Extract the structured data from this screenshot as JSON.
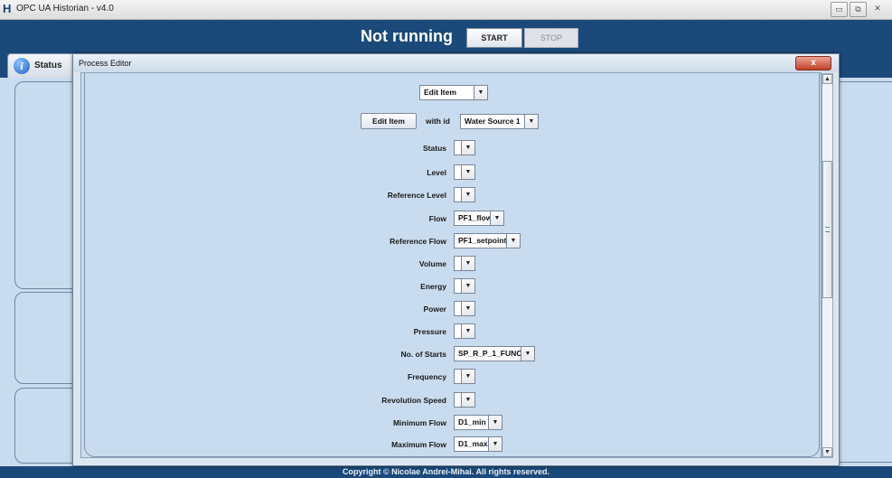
{
  "window": {
    "title": "OPC UA Historian - v4.0",
    "app_icon_glyph": "H",
    "controls": [
      "▭",
      "⧉",
      "✕"
    ]
  },
  "header": {
    "status": "Not running",
    "start_label": "START",
    "stop_label": "STOP"
  },
  "tabs": {
    "status_label": "Status"
  },
  "footer": {
    "text": "Copyright © Nicolae Andrei-Mihai. All rights reserved."
  },
  "dialog": {
    "title": "Process Editor",
    "close_glyph": "x",
    "mode_select": "Edit Item",
    "edit_button": "Edit Item",
    "with_id_label": "with id",
    "id_select": "Water Source 1",
    "fields": [
      {
        "label": "Status",
        "value": ""
      },
      {
        "label": "Level",
        "value": ""
      },
      {
        "label": "Reference Level",
        "value": ""
      },
      {
        "label": "Flow",
        "value": "PF1_flow"
      },
      {
        "label": "Reference Flow",
        "value": "PF1_setpoint"
      },
      {
        "label": "Volume",
        "value": ""
      },
      {
        "label": "Energy",
        "value": ""
      },
      {
        "label": "Power",
        "value": ""
      },
      {
        "label": "Pressure",
        "value": ""
      },
      {
        "label": "No. of Starts",
        "value": "SP_R_P_1_FUNC"
      },
      {
        "label": "Frequency",
        "value": ""
      },
      {
        "label": "Revolution Speed",
        "value": ""
      },
      {
        "label": "Minimum Flow",
        "value": "D1_min"
      },
      {
        "label": "Maximum Flow",
        "value": "D1_max"
      }
    ]
  },
  "icons": {
    "app": "app-logo-icon",
    "status_tab": "info-icon",
    "dropdown": "chevron-down-icon"
  },
  "colors": {
    "header_bg": "#1b4a7a",
    "panel_bg": "#c9dcef",
    "dialog_close": "#c2412a"
  }
}
